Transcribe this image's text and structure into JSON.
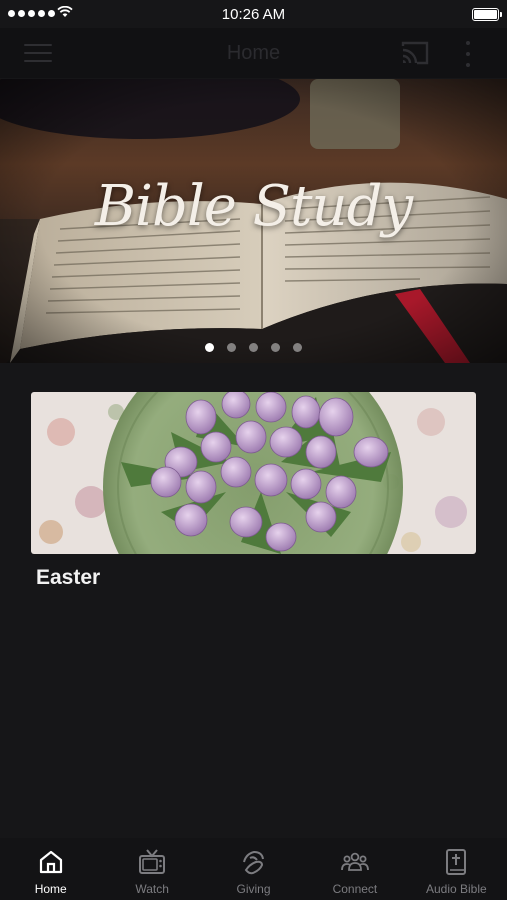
{
  "status_bar": {
    "time": "10:26 AM"
  },
  "nav": {
    "title": "Home"
  },
  "hero": {
    "title": "Bible Study",
    "slide_count": 5,
    "active_slide": 1
  },
  "featured": {
    "title": "Easter"
  },
  "tabs": [
    {
      "label": "Home",
      "icon": "home-icon",
      "active": true
    },
    {
      "label": "Watch",
      "icon": "tv-icon",
      "active": false
    },
    {
      "label": "Giving",
      "icon": "giving-hand-icon",
      "active": false
    },
    {
      "label": "Connect",
      "icon": "group-icon",
      "active": false
    },
    {
      "label": "Audio Bible",
      "icon": "bible-icon",
      "active": false
    }
  ],
  "colors": {
    "background": "#161618",
    "active_tab": "#ffffff",
    "inactive_tab": "#7c7c80"
  }
}
